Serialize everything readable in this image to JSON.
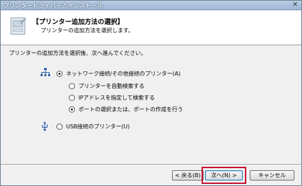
{
  "window": {
    "title": "プリンタードライバーのインストール",
    "close_glyph": "×"
  },
  "header": {
    "title": "【プリンター追加方法の選択】",
    "subtitle": "プリンターの追加方法を選択します。"
  },
  "instruction": "プリンターの追加方法を選択後、次へ進んでください。",
  "options": {
    "network": {
      "label": "ネットワーク接続/その他接続のプリンター(A)",
      "checked": true,
      "icon": "network-icon"
    },
    "auto_search": {
      "label": "プリンターを自動検索する",
      "checked": false
    },
    "ip_search": {
      "label": "IPアドレスを指定して検索する",
      "checked": false
    },
    "port_select": {
      "label": "ポートの選択または、ポートの作成を行う",
      "checked": true
    },
    "usb": {
      "label": "USB接続のプリンター(U)",
      "checked": false,
      "icon": "usb-icon"
    }
  },
  "buttons": {
    "back": "< 戻る(B)",
    "next": "次へ(N) >",
    "cancel": "キャンセル"
  },
  "colors": {
    "highlight": "#c8102e",
    "titlebar": "#9fb8d6"
  }
}
